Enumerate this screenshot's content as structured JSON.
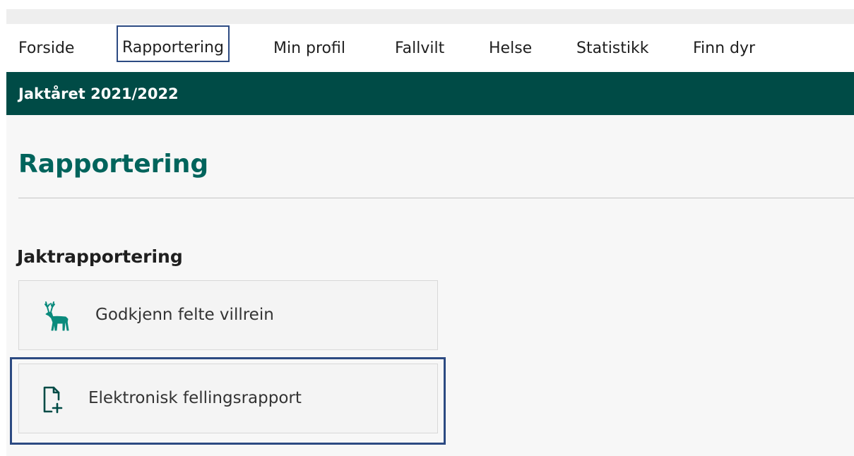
{
  "nav": {
    "items": [
      {
        "label": "Forside"
      },
      {
        "label": "Rapportering"
      },
      {
        "label": "Min profil"
      },
      {
        "label": "Fallvilt"
      },
      {
        "label": "Helse"
      },
      {
        "label": "Statistikk"
      },
      {
        "label": "Finn dyr"
      }
    ],
    "active": "Rapportering"
  },
  "season_band": {
    "label": "Jaktåret 2021/2022"
  },
  "page": {
    "title": "Rapportering"
  },
  "section": {
    "heading": "Jaktrapportering",
    "cards": [
      {
        "label": "Godkjenn felte villrein",
        "icon": "reindeer-icon"
      },
      {
        "label": "Elektronisk fellingsrapport",
        "icon": "document-add-icon"
      }
    ]
  },
  "colors": {
    "band": "#004b46",
    "title": "#00645c",
    "icon_teal": "#0a8a7c",
    "highlight_outline": "#2c4a82"
  }
}
